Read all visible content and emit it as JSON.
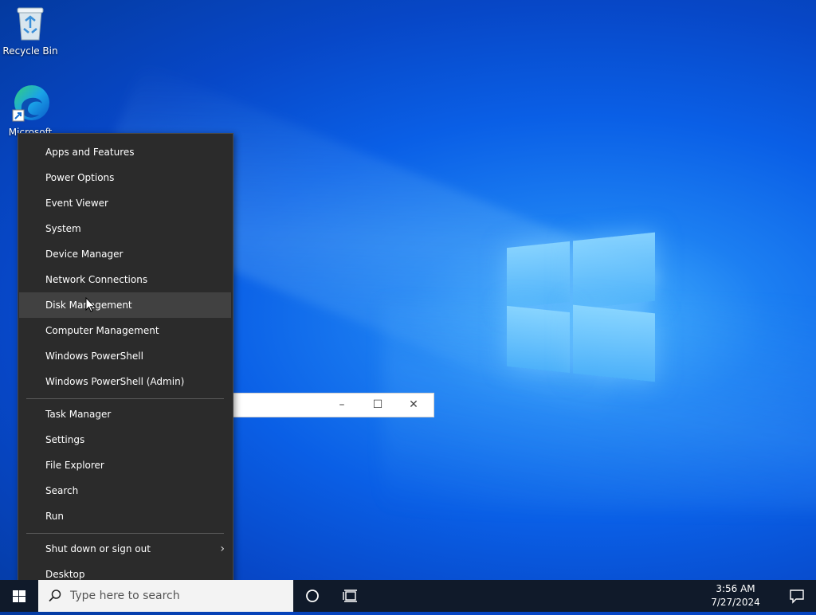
{
  "desktop": {
    "icons": [
      {
        "label": "Recycle Bin",
        "icon": "recycle-bin-icon"
      },
      {
        "label": "Microsoft",
        "icon": "edge-icon"
      }
    ]
  },
  "context_menu": {
    "group1": [
      "Apps and Features",
      "Power Options",
      "Event Viewer",
      "System",
      "Device Manager",
      "Network Connections",
      "Disk Management",
      "Computer Management",
      "Windows PowerShell",
      "Windows PowerShell (Admin)"
    ],
    "group2": [
      "Task Manager",
      "Settings",
      "File Explorer",
      "Search",
      "Run"
    ],
    "group3": [
      "Shut down or sign out",
      "Desktop"
    ],
    "hovered_item": "Disk Management",
    "submenu_indicator": "›"
  },
  "background_window": {
    "minimize": "–",
    "maximize": "☐",
    "close": "✕"
  },
  "taskbar": {
    "search_placeholder": "Type here to search",
    "time": "3:56 AM",
    "date": "7/27/2024"
  },
  "colors": {
    "menu_bg": "#2b2b2b",
    "menu_hover": "#414141",
    "taskbar_bg": "#101a2a",
    "accent": "#0a5fe6"
  }
}
